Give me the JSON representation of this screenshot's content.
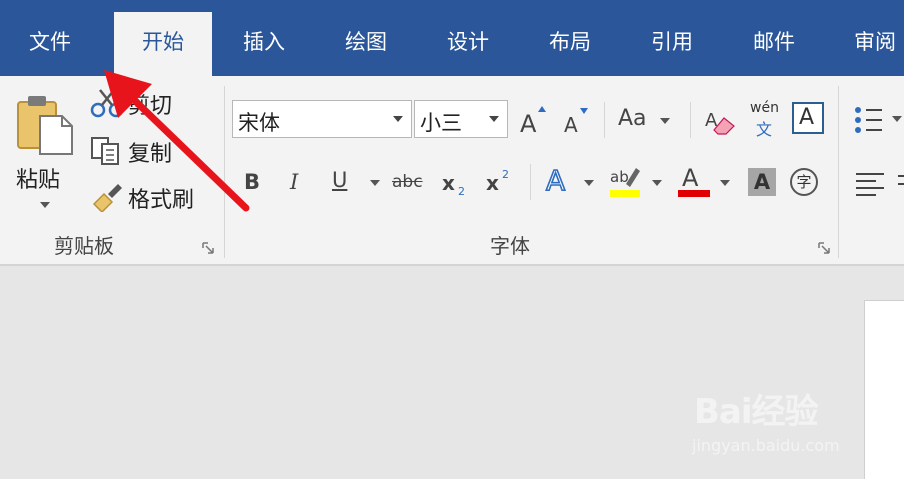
{
  "tabs": [
    {
      "label": "文件",
      "active": false
    },
    {
      "label": "开始",
      "active": true
    },
    {
      "label": "插入",
      "active": false
    },
    {
      "label": "绘图",
      "active": false
    },
    {
      "label": "设计",
      "active": false
    },
    {
      "label": "布局",
      "active": false
    },
    {
      "label": "引用",
      "active": false
    },
    {
      "label": "邮件",
      "active": false
    },
    {
      "label": "审阅",
      "active": false
    }
  ],
  "clipboard": {
    "paste_label": "粘贴",
    "cut_label": "剪切",
    "copy_label": "复制",
    "format_painter_label": "格式刷",
    "group_label": "剪贴板"
  },
  "font": {
    "font_name": "宋体",
    "font_size": "小三",
    "change_case_label": "Aa",
    "phonetic_label": "wén",
    "phonetic_char": "文",
    "border_char": "A",
    "enclose_char": "字",
    "group_label": "字体"
  },
  "watermark": {
    "brand": "Bai经验",
    "url": "jingyan.baidu.com"
  },
  "colors": {
    "tab_bar": "#2b579a",
    "ribbon_bg": "#f3f3f3",
    "highlight_yellow": "#ffff00",
    "font_color_red": "#e00000",
    "annotation_arrow": "#e8141b"
  },
  "icons": [
    "clipboard-paste-icon",
    "scissors-icon",
    "copy-icon",
    "format-painter-icon",
    "grow-font-icon",
    "shrink-font-icon",
    "clear-formatting-icon",
    "phonetic-guide-icon",
    "character-border-icon",
    "bold-icon",
    "italic-icon",
    "underline-icon",
    "strikethrough-icon",
    "subscript-icon",
    "superscript-icon",
    "text-effects-icon",
    "highlight-icon",
    "font-color-icon",
    "character-shading-icon",
    "enclose-character-icon",
    "bullets-icon",
    "align-left-icon",
    "annotation-arrow-icon"
  ]
}
